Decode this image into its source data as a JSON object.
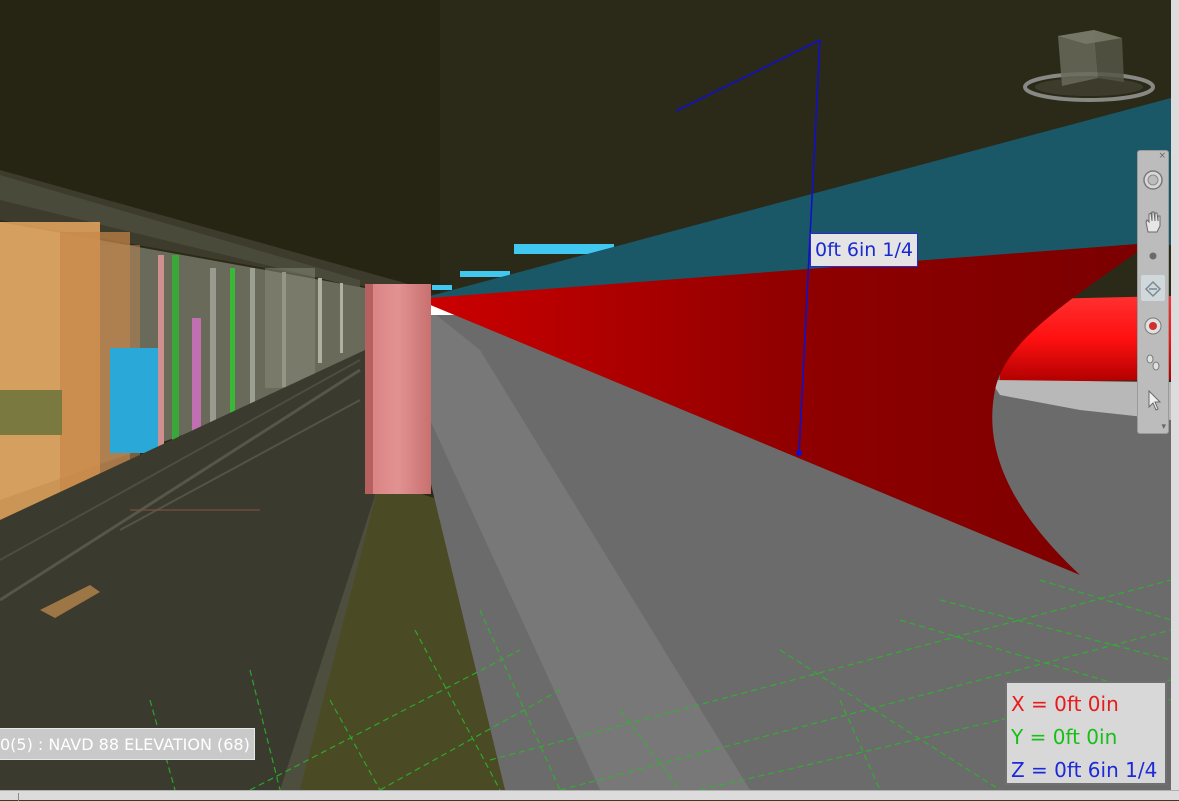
{
  "measurement": {
    "distance_label": "0ft 6in 1/4"
  },
  "level_label": "0(5) : NAVD 88 ELEVATION (68)",
  "coordinates": {
    "x": "X = 0ft 0in",
    "y": "Y = 0ft 0in",
    "z": "Z = 0ft 6in 1/4",
    "x_color": "#e81a1a",
    "y_color": "#16c016",
    "z_color": "#1c2ad8"
  },
  "navigation_bar": {
    "tools": [
      "full-navigation-wheel-icon",
      "pan-icon",
      "zoom-icon",
      "orbit-icon",
      "look-around-icon",
      "walk-icon",
      "select-icon"
    ],
    "close_glyph": "×",
    "menu_glyph": "▾"
  },
  "viewcube": {
    "icon": "viewcube-icon"
  },
  "colors": {
    "ceiling": "#2b2a18",
    "floor": "#6b6b6b",
    "red_element": "#8a0000",
    "teal_pipe": "#1a5868",
    "measure_line": "#1010c8",
    "grid": "#2ab82a"
  }
}
